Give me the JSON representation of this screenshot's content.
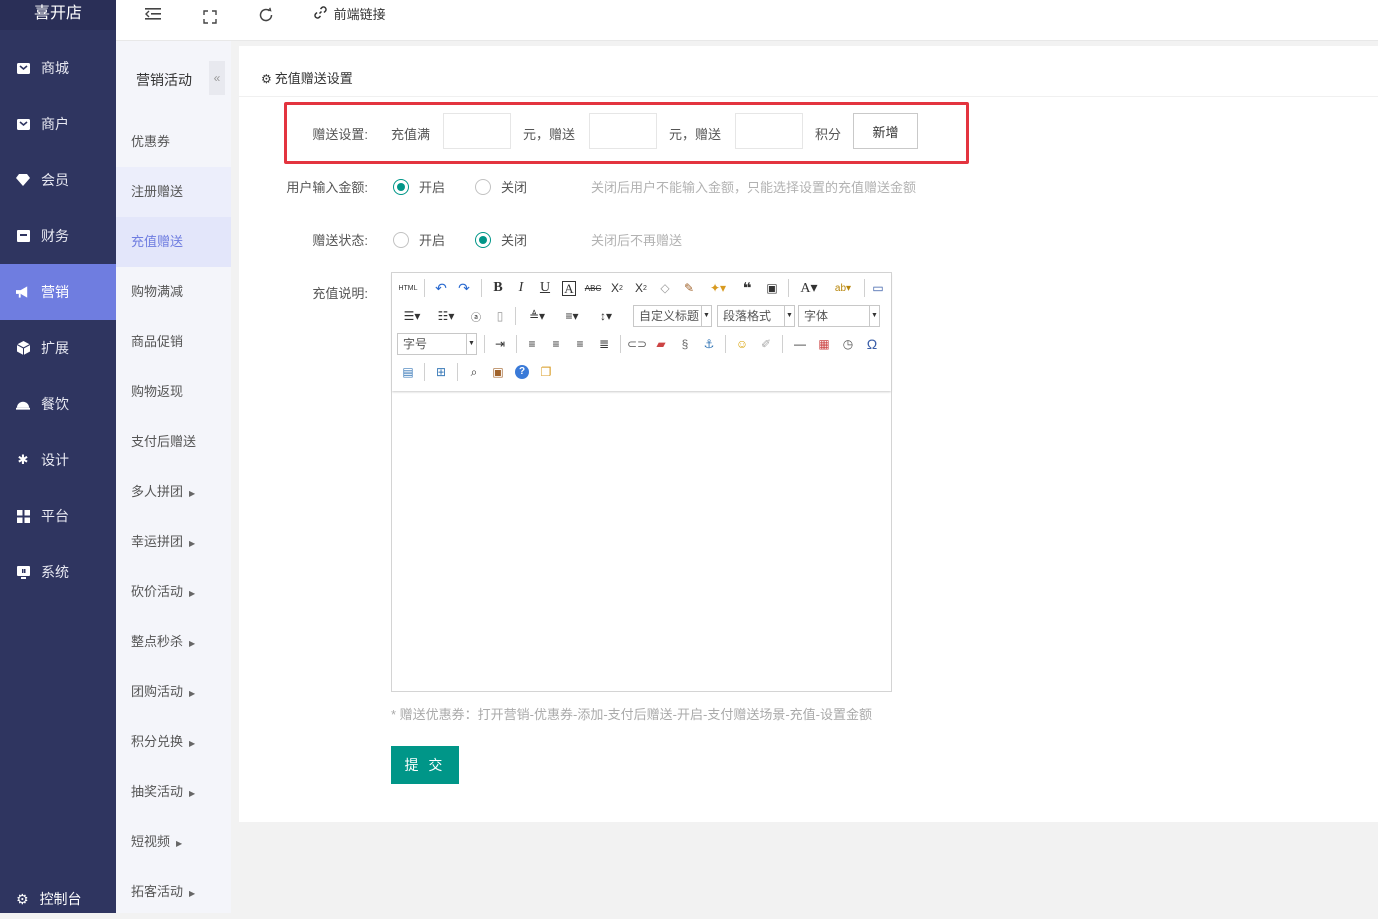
{
  "brand": "喜开店",
  "nav": [
    {
      "label": "商城",
      "icon": "shop-icon"
    },
    {
      "label": "商户",
      "icon": "merchant-icon"
    },
    {
      "label": "会员",
      "icon": "member-icon"
    },
    {
      "label": "财务",
      "icon": "finance-icon"
    },
    {
      "label": "营销",
      "icon": "megaphone-icon"
    },
    {
      "label": "扩展",
      "icon": "cube-icon"
    },
    {
      "label": "餐饮",
      "icon": "dining-icon"
    },
    {
      "label": "设计",
      "icon": "puzzle-icon"
    },
    {
      "label": "平台",
      "icon": "grid-icon"
    },
    {
      "label": "系统",
      "icon": "monitor-icon"
    }
  ],
  "nav_bottom": "控制台",
  "submenu": {
    "title": "营销活动",
    "collapse": "«",
    "items": [
      {
        "label": "优惠券"
      },
      {
        "label": "注册赠送"
      },
      {
        "label": "充值赠送"
      },
      {
        "label": "购物满减"
      },
      {
        "label": "商品促销"
      },
      {
        "label": "购物返现"
      },
      {
        "label": "支付后赠送"
      },
      {
        "label": "多人拼团"
      },
      {
        "label": "幸运拼团"
      },
      {
        "label": "砍价活动"
      },
      {
        "label": "整点秒杀"
      },
      {
        "label": "团购活动"
      },
      {
        "label": "积分兑换"
      },
      {
        "label": "抽奖活动"
      },
      {
        "label": "短视频"
      },
      {
        "label": "拓客活动"
      }
    ]
  },
  "topbar": {
    "frontend_link": "前端链接"
  },
  "panel": {
    "title": "充值赠送设置",
    "gift": {
      "label": "赠送设置:",
      "recharge_full": "充值满",
      "yuan_gift_1": "元，赠送",
      "yuan_gift_2": "元，赠送",
      "points": "积分",
      "add_button": "新增"
    },
    "user_input": {
      "label": "用户输入金额:",
      "on": "开启",
      "off": "关闭",
      "hint": "关闭后用户不能输入金额，只能选择设置的充值赠送金额"
    },
    "gift_status": {
      "label": "赠送状态:",
      "on": "开启",
      "off": "关闭",
      "hint": "关闭后不再赠送"
    },
    "description_label": "充值说明:",
    "editor": {
      "custom_title": "自定义标题",
      "paragraph": "段落格式",
      "font": "字体",
      "font_size": "字号"
    },
    "note": "* 赠送优惠券：打开营销-优惠券-添加-支付后赠送-开启-支付赠送场景-充值-设置金额",
    "submit": "提 交"
  },
  "colors": {
    "sidebar": "#2f3560",
    "active": "#6f7de0",
    "primary": "#009688",
    "highlight": "#e3343f"
  }
}
